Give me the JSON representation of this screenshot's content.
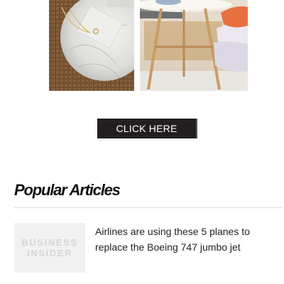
{
  "products": {
    "left_image": "marble tray with jewelry on woven mat",
    "right_image": "round side table with cushions"
  },
  "cta": {
    "label": "CLICK HERE"
  },
  "popular": {
    "title": "Popular Articles",
    "articles": [
      {
        "headline": "Airlines are using these 5 planes to replace the Boeing 747 jumbo jet",
        "thumb_logo_line1": "BUSINESS",
        "thumb_logo_line2": "INSIDER"
      }
    ]
  },
  "colors": {
    "button_bg": "#231f20",
    "button_text": "#ffffff",
    "heading": "#111111",
    "divider": "#dddddd",
    "thumb_bg": "#f1f1f1",
    "thumb_logo": "#d6d6d6"
  }
}
